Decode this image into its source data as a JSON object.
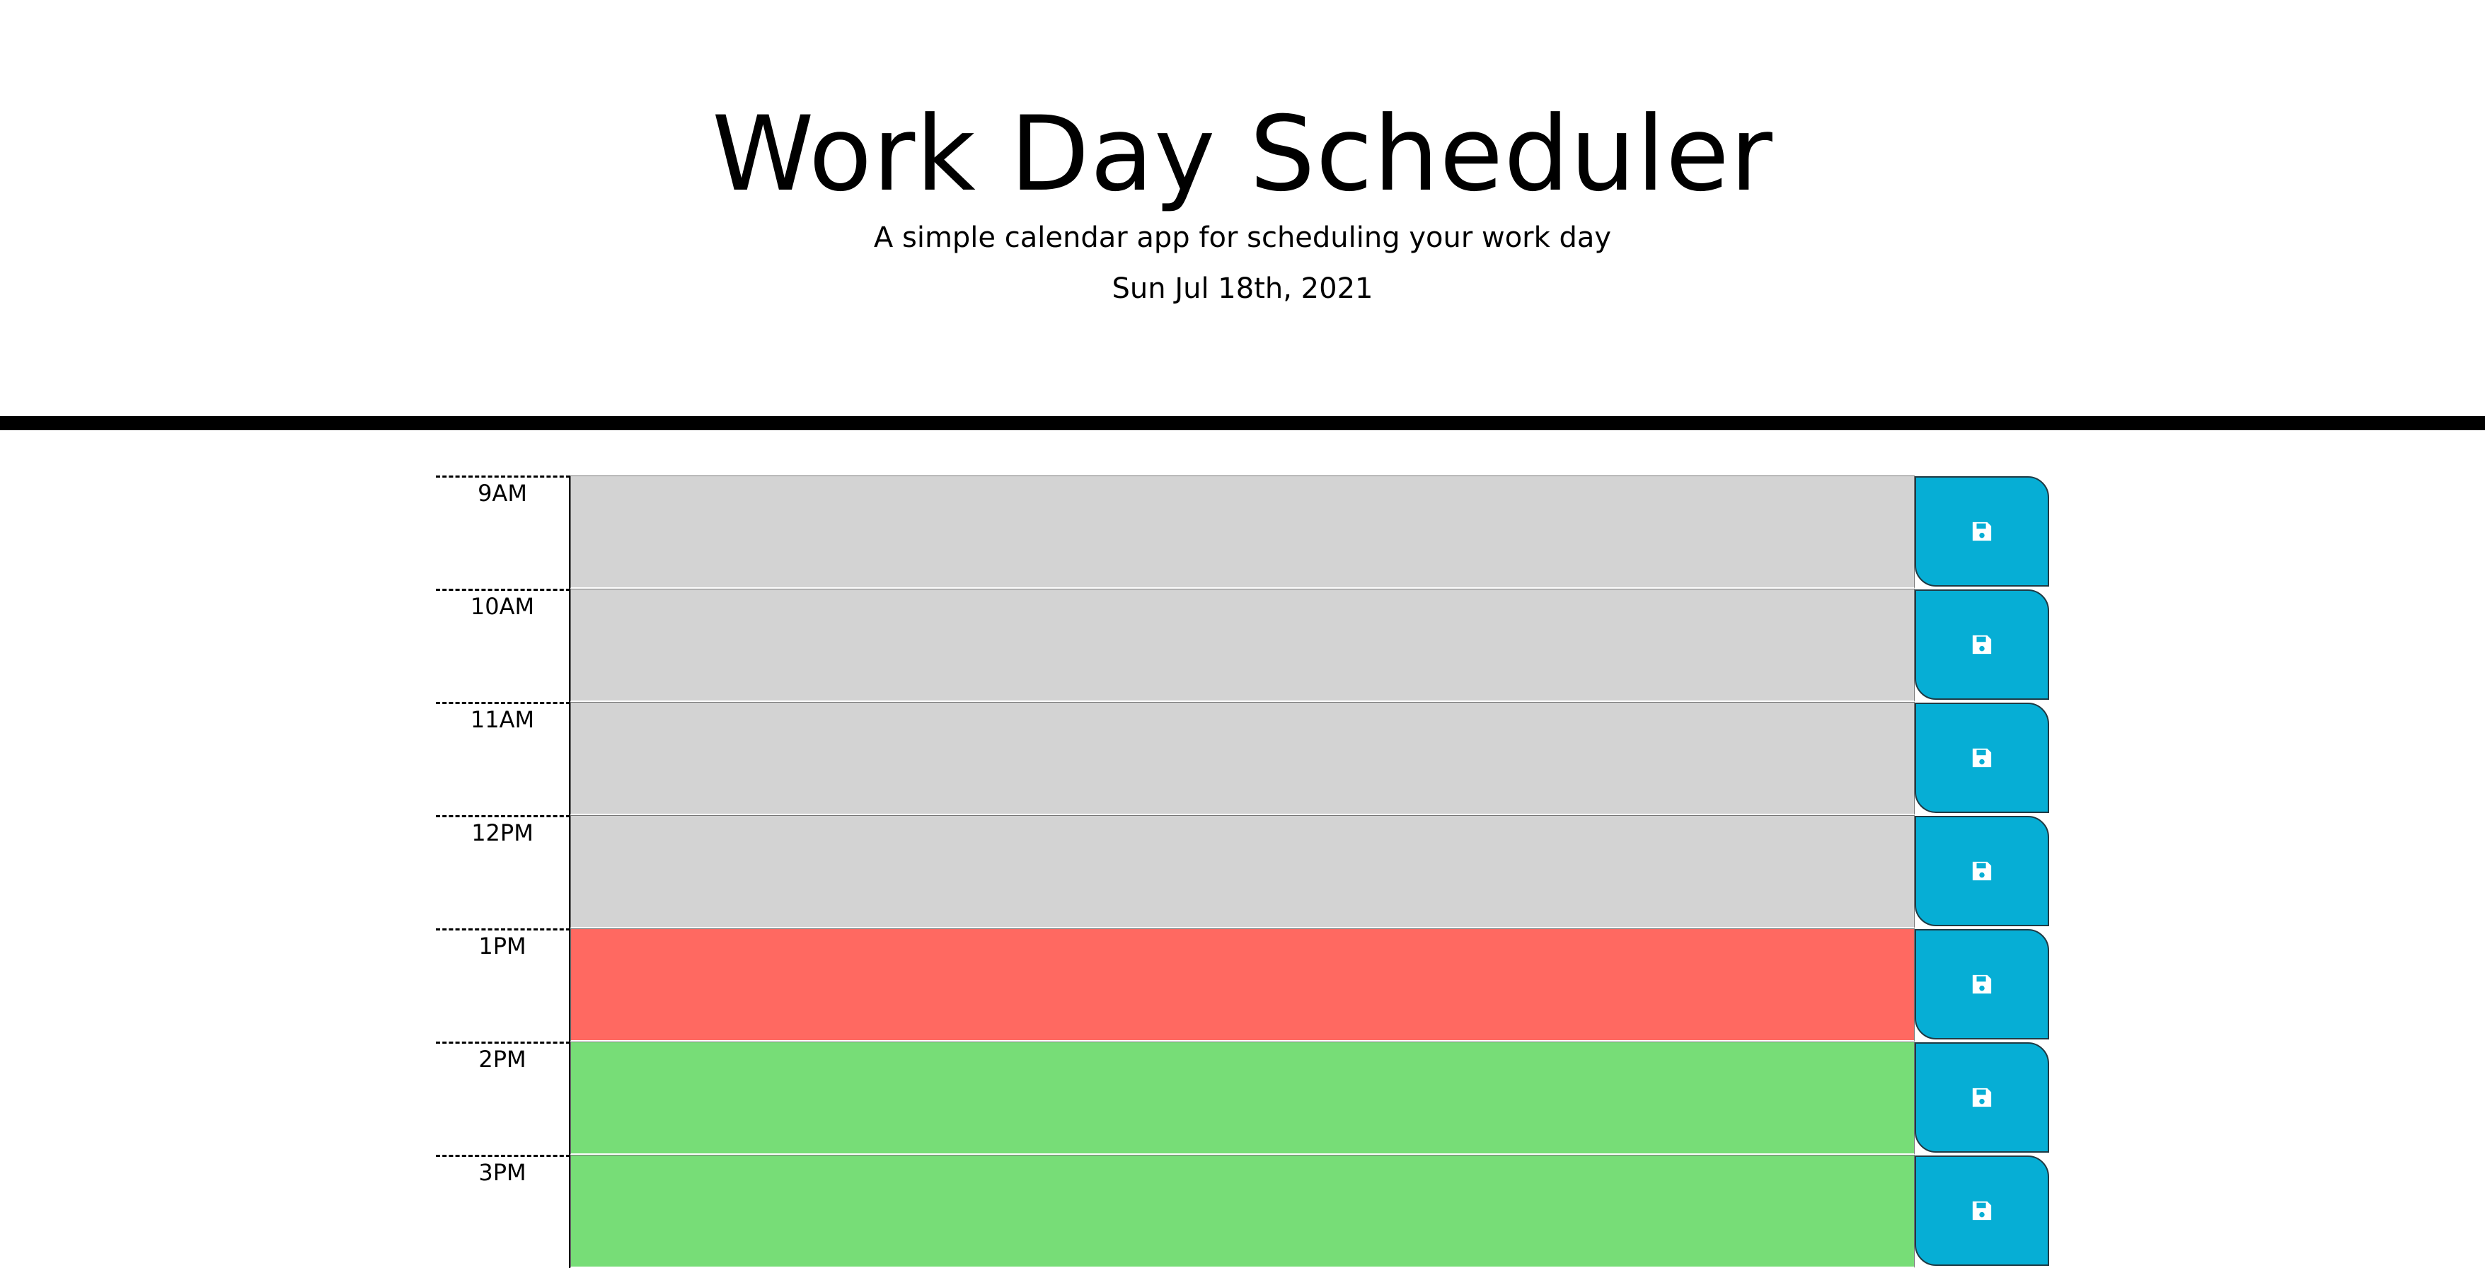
{
  "header": {
    "title": "Work Day Scheduler",
    "subtitle": "A simple calendar app for scheduling your work day",
    "current_day": "Sun Jul 18th, 2021"
  },
  "colors": {
    "past": "#d3d3d3",
    "present": "#ff6961",
    "future": "#77dd77",
    "save_button": "#06aed5"
  },
  "schedule": [
    {
      "hour": "9AM",
      "status": "past",
      "text": "",
      "save_icon": "floppy-disk-icon"
    },
    {
      "hour": "10AM",
      "status": "past",
      "text": "",
      "save_icon": "floppy-disk-icon"
    },
    {
      "hour": "11AM",
      "status": "past",
      "text": "",
      "save_icon": "floppy-disk-icon"
    },
    {
      "hour": "12PM",
      "status": "past",
      "text": "",
      "save_icon": "floppy-disk-icon"
    },
    {
      "hour": "1PM",
      "status": "present",
      "text": "",
      "save_icon": "floppy-disk-icon"
    },
    {
      "hour": "2PM",
      "status": "future",
      "text": "",
      "save_icon": "floppy-disk-icon"
    },
    {
      "hour": "3PM",
      "status": "future",
      "text": "",
      "save_icon": "floppy-disk-icon"
    }
  ]
}
